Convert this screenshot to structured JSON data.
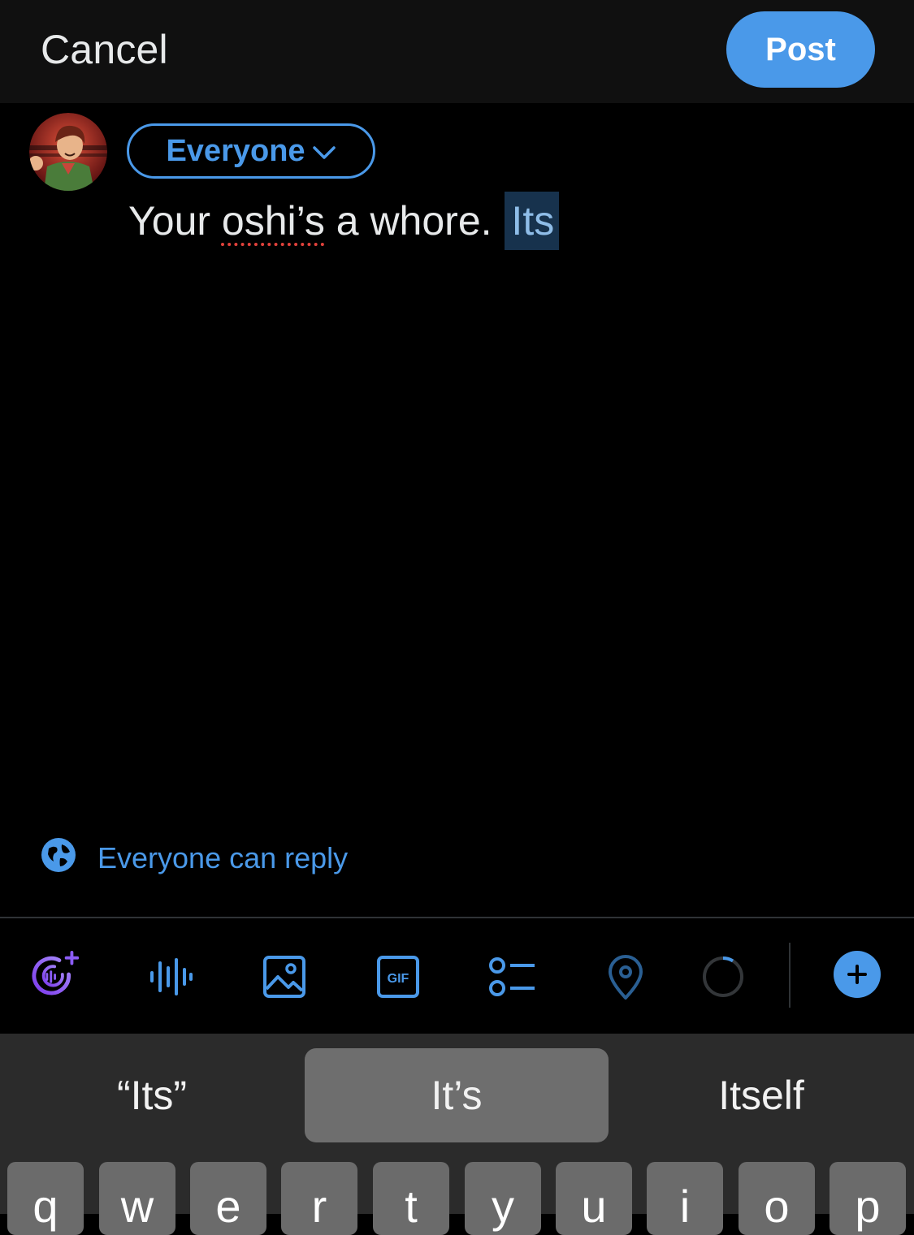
{
  "header": {
    "cancel_label": "Cancel",
    "post_label": "Post"
  },
  "composer": {
    "audience_label": "Everyone",
    "text_before": "Your ",
    "misspelled_word": "oshi’s",
    "text_middle": " a whore. ",
    "selected_word": "Its"
  },
  "reply_setting": {
    "label": "Everyone can reply",
    "icon": "globe-icon"
  },
  "toolbar": {
    "icons": [
      "grok-add-icon",
      "audio-wave-icon",
      "image-icon",
      "gif-icon",
      "poll-icon",
      "location-icon",
      "char-count-ring-icon",
      "add-post-icon"
    ],
    "gif_text": "GIF"
  },
  "keyboard": {
    "suggestions": [
      "“Its”",
      "It’s",
      "Itself"
    ],
    "active_suggestion_index": 1,
    "keys": [
      "q",
      "w",
      "e",
      "r",
      "t",
      "y",
      "u",
      "i",
      "o",
      "p"
    ]
  },
  "colors": {
    "accent": "#4a99e9",
    "background": "#000000",
    "grok": "#8b5cf6"
  }
}
